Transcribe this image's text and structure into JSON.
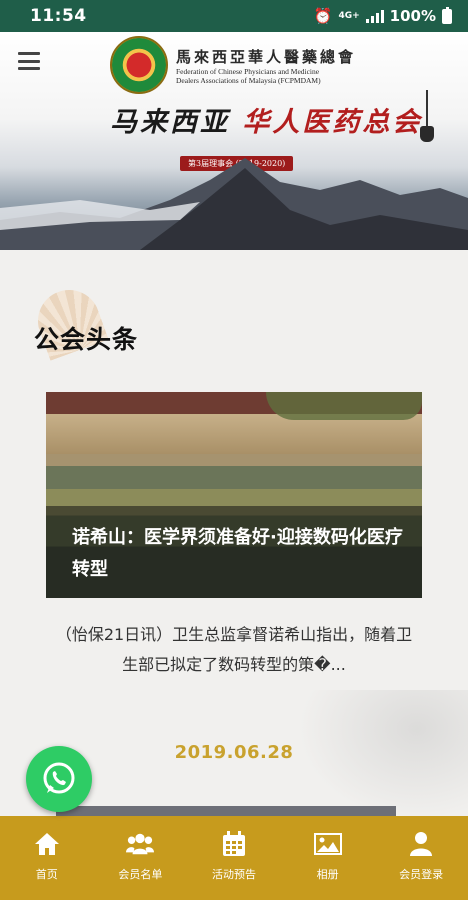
{
  "status_bar": {
    "time": "11:54",
    "network": "4G+",
    "battery": "100%"
  },
  "header": {
    "org_name_cn": "馬來西亞華人醫藥總會",
    "org_name_en_line1": "Federation of Chinese Physicians and Medicine",
    "org_name_en_line2": "Dealers Associations of Malaysia (FCPMDAM)",
    "calligraphy_a": "马来西亚",
    "calligraphy_b": "华人医药总会",
    "term_stamp": "第3届理事会 (2019-2020)"
  },
  "section": {
    "title": "公会头条"
  },
  "news": [
    {
      "title": "诺希山：医学界须准备好·迎接数码化医疗转型",
      "excerpt": "（怡保21日讯）卫生总监拿督诺希山指出，随着卫生部已拟定了数码转型的策�...",
      "date": "2019.06.28"
    }
  ],
  "bottom_nav": [
    {
      "label": "首页",
      "icon": "home-icon"
    },
    {
      "label": "会员名单",
      "icon": "members-icon"
    },
    {
      "label": "活动预告",
      "icon": "calendar-icon"
    },
    {
      "label": "相册",
      "icon": "photo-icon"
    },
    {
      "label": "会员登录",
      "icon": "user-icon"
    }
  ],
  "colors": {
    "status_bar": "#1f5e49",
    "nav_bg": "#c79b1d",
    "date": "#c9a22e",
    "whatsapp": "#2ecc65"
  }
}
